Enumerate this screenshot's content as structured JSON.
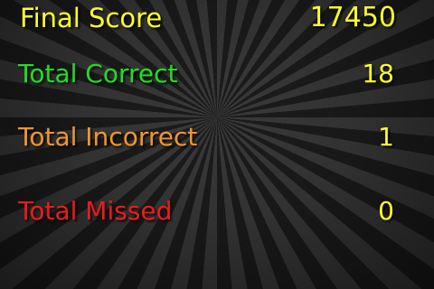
{
  "colors": {
    "final": "#fdfd2d",
    "correct": "#22dd22",
    "incorrect": "#f0962e",
    "missed": "#ee1a1a",
    "value": "#fdfd2d"
  },
  "results": {
    "final_score": {
      "label": "Final Score",
      "value": "17450"
    },
    "total_correct": {
      "label": "Total Correct",
      "value": "18"
    },
    "total_incorrect": {
      "label": "Total Incorrect",
      "value": "1"
    },
    "total_missed": {
      "label": "Total Missed",
      "value": "0"
    }
  }
}
